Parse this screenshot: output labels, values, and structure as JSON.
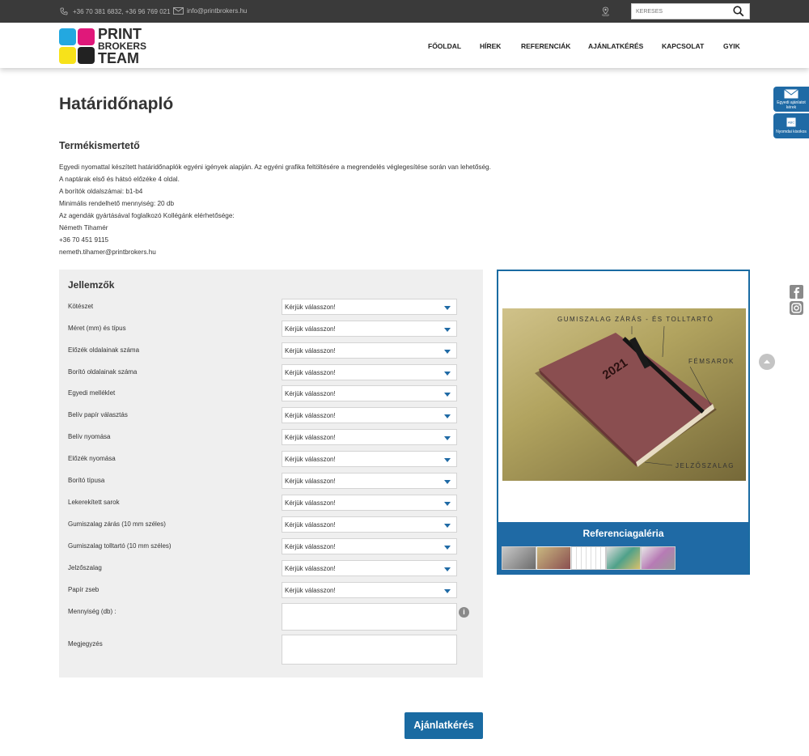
{
  "topbar": {
    "phones": "+36 70 381 6832, +36 96 769 021",
    "email": "info@printbrokers.hu",
    "search_placeholder": "KERESÉS"
  },
  "logo": {
    "line1": "PRINT",
    "line2": "BROKERS",
    "line3": "TEAM"
  },
  "nav": {
    "items": [
      "FŐOLDAL",
      "HÍREK",
      "REFERENCIÁK",
      "AJÁNLATKÉRÉS",
      "KAPCSOLAT",
      "GYIK"
    ]
  },
  "page": {
    "title": "Határidőnapló",
    "subtitle": "Termékismertető",
    "description": [
      "Egyedi nyomattal készített határidőnaplók egyéni igények alapján. Az egyéni grafika feltöltésére a megrendelés véglegesítése során van lehetőség.",
      "A naptárak első és hátsó előzéke 4 oldal.",
      "A borítók oldalszámai: b1-b4",
      "Minimális rendelhető mennyiség: 20 db",
      "Az agendák gyártásával foglalkozó Kollégánk elérhetősége:",
      "Németh Tihamér",
      "+36 70 451 9115",
      "nemeth.tihamer@printbrokers.hu"
    ]
  },
  "form": {
    "title": "Jellemzők",
    "select_placeholder": "Kérjük válasszon!",
    "fields": [
      "Kötészet",
      "Méret (mm) és típus",
      "Előzék oldalainak száma",
      "Borító oldalainak száma",
      "Egyedi melléklet",
      "Belív papír választás",
      "Belív nyomása",
      "Előzék nyomása",
      "Borító típusa",
      "Lekerekített sarok",
      "Gumiszalag zárás (10 mm széles)",
      "Gumiszalag tolltartó (10 mm széles)",
      "Jelzőszalag",
      "Papír zseb"
    ],
    "quantity_label": "Mennyiség (db) :",
    "note_label": "Megjegyzés",
    "info_icon": "i",
    "submit_label": "Ajánlatkérés"
  },
  "gallery": {
    "title": "Referenciagaléria",
    "image_labels": {
      "strap": "GUMISZALAG ZÁRÁS - ÉS TOLLTARTÓ",
      "corner": "FÉMSAROK",
      "ribbon": "JELZŐSZALAG",
      "year": "2021"
    }
  },
  "side_tabs": {
    "quote": "Egyedi ajánlatot kérek",
    "print_calc": "Nyomdai kisokos"
  },
  "colors": {
    "accent": "#1f6aa5",
    "topbar": "#3a3a3a",
    "panel": "#efefef"
  }
}
